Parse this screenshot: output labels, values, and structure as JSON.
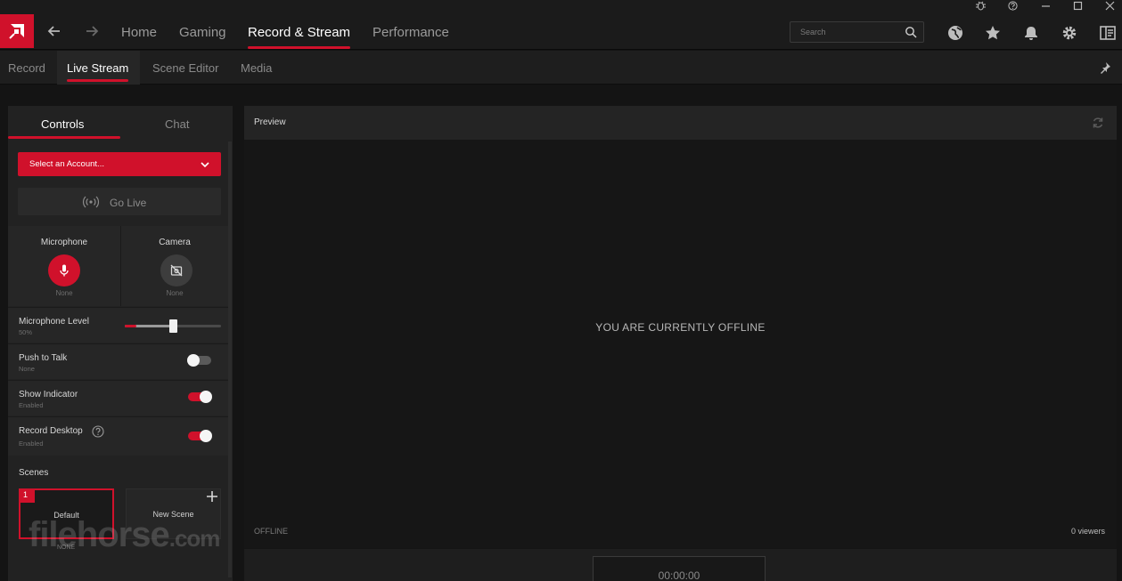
{
  "topbar": {
    "tabs": [
      {
        "label": "Home",
        "active": false
      },
      {
        "label": "Gaming",
        "active": false
      },
      {
        "label": "Record & Stream",
        "active": true
      },
      {
        "label": "Performance",
        "active": false
      }
    ],
    "search_placeholder": "Search",
    "icons": [
      "globe-icon",
      "star-icon",
      "bell-icon",
      "gear-icon",
      "layout-icon"
    ],
    "window_controls": [
      "bug-icon",
      "help-icon",
      "minimize-icon",
      "maximize-icon",
      "close-icon"
    ]
  },
  "subtabs": [
    {
      "label": "Record",
      "active": false
    },
    {
      "label": "Live Stream",
      "active": true
    },
    {
      "label": "Scene Editor",
      "active": false
    },
    {
      "label": "Media",
      "active": false
    }
  ],
  "controls": {
    "tabs": [
      {
        "label": "Controls",
        "active": true
      },
      {
        "label": "Chat",
        "active": false
      }
    ],
    "account_select": "Select an Account...",
    "go_live": "Go Live",
    "microphone": {
      "title": "Microphone",
      "value": "None"
    },
    "camera": {
      "title": "Camera",
      "value": "None"
    },
    "mic_level": {
      "title": "Microphone Level",
      "value": "50%",
      "level": 0.5
    },
    "push_to_talk": {
      "title": "Push to Talk",
      "value": "None",
      "on": false
    },
    "show_indicator": {
      "title": "Show Indicator",
      "value": "Enabled",
      "on": true
    },
    "record_desktop": {
      "title": "Record Desktop",
      "value": "Enabled",
      "on": true
    },
    "scenes_label": "Scenes",
    "scenes": [
      {
        "number": "1",
        "name": "Default",
        "sub": "NONE"
      },
      {
        "name": "New Scene"
      }
    ]
  },
  "preview": {
    "title": "Preview",
    "message": "YOU ARE CURRENTLY OFFLINE",
    "status": "OFFLINE",
    "viewers": "0 viewers",
    "timer": "00:00:00"
  },
  "watermark": {
    "text": "filehorse",
    "suffix": ".com"
  },
  "colors": {
    "accent": "#d0112b",
    "background": "#141414",
    "panel": "#222222"
  }
}
